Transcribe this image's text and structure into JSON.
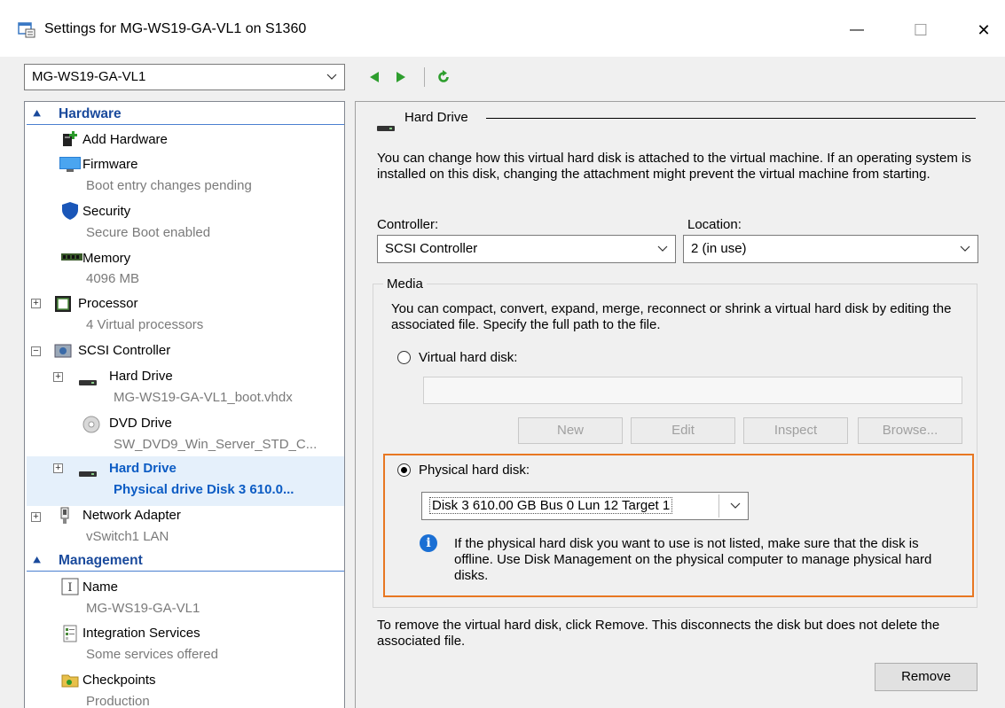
{
  "window": {
    "title": "Settings for MG-WS19-GA-VL1 on S1360",
    "minimize_glyph": "—",
    "maximize_glyph": "☐",
    "close_glyph": "✕"
  },
  "toolbar": {
    "vm_selector": "MG-WS19-GA-VL1"
  },
  "tree": {
    "hardware_section": "Hardware",
    "items": {
      "add_hardware": {
        "name": "Add Hardware"
      },
      "firmware": {
        "name": "Firmware",
        "sub": "Boot entry changes pending"
      },
      "security": {
        "name": "Security",
        "sub": "Secure Boot enabled"
      },
      "memory": {
        "name": "Memory",
        "sub": "4096 MB"
      },
      "processor": {
        "name": "Processor",
        "sub": "4 Virtual processors"
      },
      "scsi": {
        "name": "SCSI Controller"
      },
      "hard_drive_1": {
        "name": "Hard Drive",
        "sub": "MG-WS19-GA-VL1_boot.vhdx"
      },
      "dvd_drive": {
        "name": "DVD Drive",
        "sub": "SW_DVD9_Win_Server_STD_C..."
      },
      "hard_drive_2": {
        "name": "Hard Drive",
        "sub": "Physical drive Disk 3 610.0..."
      },
      "network": {
        "name": "Network Adapter",
        "sub": "vSwitch1 LAN"
      }
    },
    "management_section": "Management",
    "management_items": {
      "name": {
        "name": "Name",
        "sub": "MG-WS19-GA-VL1"
      },
      "integration": {
        "name": "Integration Services",
        "sub": "Some services offered"
      },
      "checkpoints": {
        "name": "Checkpoints",
        "sub": "Production"
      }
    }
  },
  "panel": {
    "group_title": "Hard Drive",
    "intro": "You can change how this virtual hard disk is attached to the virtual machine. If an operating system is installed on this disk, changing the attachment might prevent the virtual machine from starting.",
    "controller_label": "Controller:",
    "controller_value": "SCSI Controller",
    "location_label": "Location:",
    "location_value": "2 (in use)",
    "media_label": "Media",
    "media_desc": "You can compact, convert, expand, merge, reconnect or shrink a virtual hard disk by editing the associated file. Specify the full path to the file.",
    "vhd_radio": "Virtual hard disk:",
    "vhd_path": "",
    "buttons": {
      "new": "New",
      "edit": "Edit",
      "inspect": "Inspect",
      "browse": "Browse..."
    },
    "phys_radio": "Physical hard disk:",
    "phys_value": "Disk 3 610.00 GB Bus 0 Lun 12 Target 1",
    "info_text": "If the physical hard disk you want to use is not listed, make sure that the disk is offline. Use Disk Management on the physical computer to manage physical hard disks.",
    "remove_text": "To remove the virtual hard disk, click Remove. This disconnects the disk but does not delete the associated file.",
    "remove_button": "Remove"
  },
  "colors": {
    "accent": "#1a4a9c",
    "selection": "#0c5cc4",
    "highlight": "#e87722",
    "nav_green": "#2e9e2e"
  }
}
